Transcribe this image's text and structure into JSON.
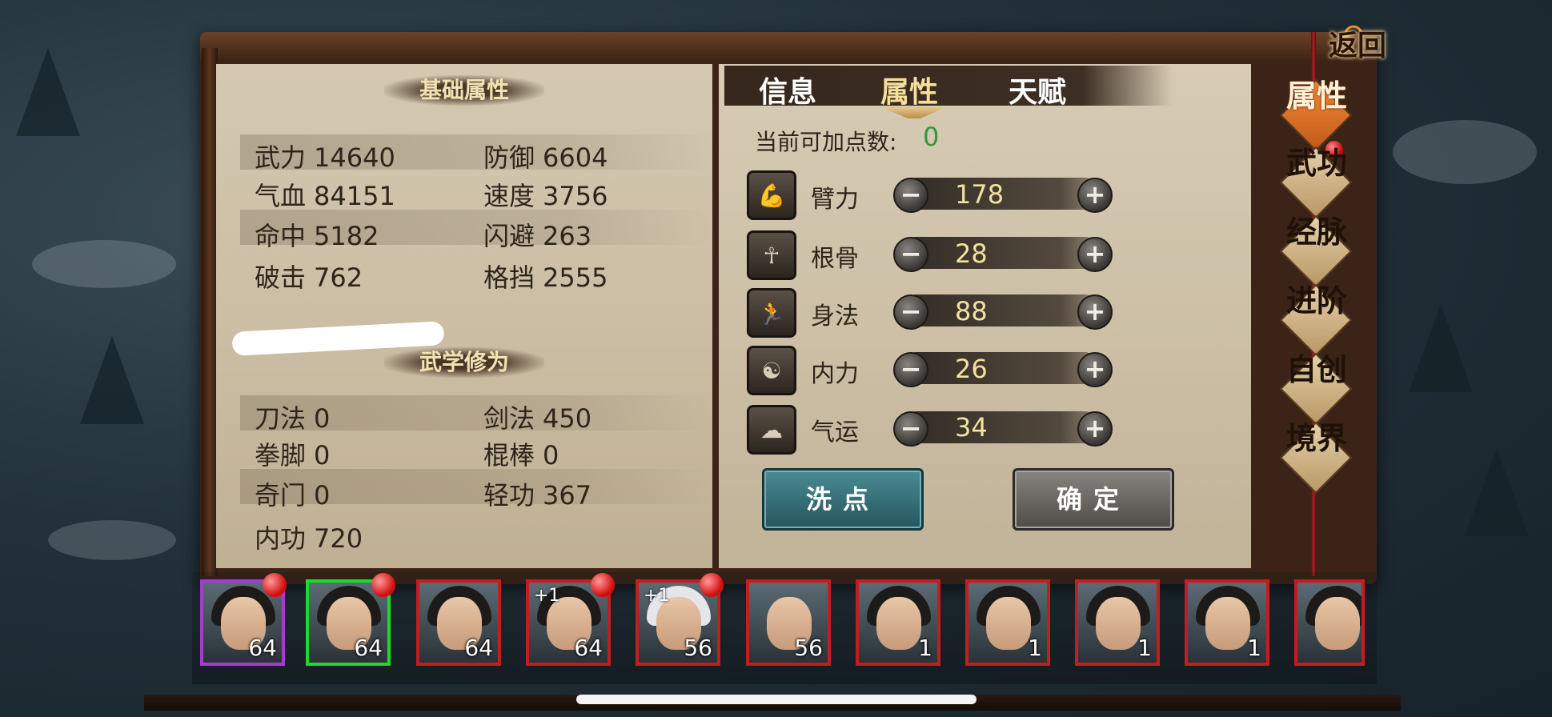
{
  "base_section": {
    "title": "基础属性",
    "stats": [
      {
        "label": "武力",
        "value": "14640"
      },
      {
        "label": "防御",
        "value": "6604"
      },
      {
        "label": "气血",
        "value": "84151"
      },
      {
        "label": "速度",
        "value": "3756"
      },
      {
        "label": "命中",
        "value": "5182"
      },
      {
        "label": "闪避",
        "value": "263"
      },
      {
        "label": "破击",
        "value": "762"
      },
      {
        "label": "格挡",
        "value": "2555"
      }
    ]
  },
  "martial_section": {
    "title": "武学修为",
    "stats": [
      {
        "label": "刀法",
        "value": "0"
      },
      {
        "label": "剑法",
        "value": "450"
      },
      {
        "label": "拳脚",
        "value": "0"
      },
      {
        "label": "棍棒",
        "value": "0"
      },
      {
        "label": "奇门",
        "value": "0"
      },
      {
        "label": "轻功",
        "value": "367"
      },
      {
        "label": "内功",
        "value": "720"
      }
    ]
  },
  "tabs": [
    {
      "label": "信息",
      "active": false
    },
    {
      "label": "属性",
      "active": true
    },
    {
      "label": "天赋",
      "active": false
    }
  ],
  "points": {
    "label": "当前可加点数:",
    "value": "0",
    "value_color": "#2e9a3c"
  },
  "attributes": [
    {
      "name": "臂力",
      "value": "178",
      "icon": "arm-icon"
    },
    {
      "name": "根骨",
      "value": "28",
      "icon": "skeleton-icon"
    },
    {
      "name": "身法",
      "value": "88",
      "icon": "running-icon"
    },
    {
      "name": "内力",
      "value": "26",
      "icon": "meditation-icon"
    },
    {
      "name": "气运",
      "value": "34",
      "icon": "cloud-icon"
    }
  ],
  "buttons": {
    "wash": "洗点",
    "confirm": "确定"
  },
  "side_menu": {
    "back": "返回",
    "items": [
      {
        "label": "属性",
        "active": true,
        "badge": true
      },
      {
        "label": "武功",
        "active": false,
        "badge": false
      },
      {
        "label": "经脉",
        "active": false,
        "badge": false
      },
      {
        "label": "进阶",
        "active": false,
        "badge": false
      },
      {
        "label": "自创",
        "active": false,
        "badge": false
      },
      {
        "label": "境界",
        "active": false,
        "badge": false
      }
    ]
  },
  "characters": [
    {
      "level": "64",
      "plus": "",
      "frame": "purple",
      "badge": true
    },
    {
      "level": "64",
      "plus": "",
      "frame": "green",
      "badge": true
    },
    {
      "level": "64",
      "plus": "",
      "frame": "red",
      "badge": false
    },
    {
      "level": "64",
      "plus": "+1",
      "frame": "red",
      "badge": true
    },
    {
      "level": "56",
      "plus": "+1",
      "frame": "red",
      "badge": true
    },
    {
      "level": "56",
      "plus": "",
      "frame": "red",
      "badge": false
    },
    {
      "level": "1",
      "plus": "",
      "frame": "red",
      "badge": false
    },
    {
      "level": "1",
      "plus": "",
      "frame": "red",
      "badge": false
    },
    {
      "level": "1",
      "plus": "",
      "frame": "red",
      "badge": false
    },
    {
      "level": "1",
      "plus": "",
      "frame": "red",
      "badge": false
    },
    {
      "level": "",
      "plus": "",
      "frame": "red",
      "badge": false
    }
  ]
}
